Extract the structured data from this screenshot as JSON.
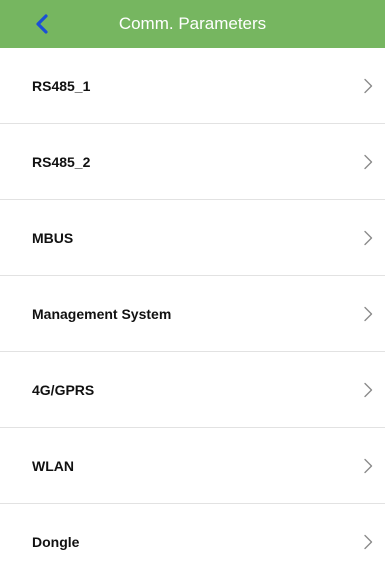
{
  "header": {
    "title": "Comm. Parameters",
    "back_icon": "chevron-left-icon",
    "background_color": "#76b660",
    "back_icon_color": "#1a4fd6"
  },
  "menu": {
    "items": [
      {
        "label": "RS485_1",
        "icon": "chevron-right-icon"
      },
      {
        "label": "RS485_2",
        "icon": "chevron-right-icon"
      },
      {
        "label": "MBUS",
        "icon": "chevron-right-icon"
      },
      {
        "label": "Management System",
        "icon": "chevron-right-icon"
      },
      {
        "label": "4G/GPRS",
        "icon": "chevron-right-icon"
      },
      {
        "label": "WLAN",
        "icon": "chevron-right-icon"
      },
      {
        "label": "Dongle",
        "icon": "chevron-right-icon"
      }
    ]
  }
}
